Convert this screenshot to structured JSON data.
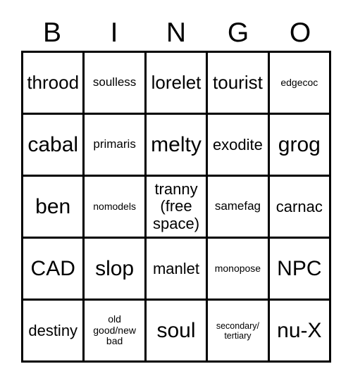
{
  "card": {
    "title_letters": [
      "B",
      "I",
      "N",
      "G",
      "O"
    ],
    "rows": [
      [
        {
          "text": "throod",
          "size": "lg"
        },
        {
          "text": "soulless",
          "size": "sm"
        },
        {
          "text": "lorelet",
          "size": "lg"
        },
        {
          "text": "tourist",
          "size": "lg"
        },
        {
          "text": "edgecoc",
          "size": "xs"
        }
      ],
      [
        {
          "text": "cabal",
          "size": "xl"
        },
        {
          "text": "primaris",
          "size": "sm"
        },
        {
          "text": "melty",
          "size": "xl"
        },
        {
          "text": "exodite",
          "size": "md"
        },
        {
          "text": "grog",
          "size": "xl"
        }
      ],
      [
        {
          "text": "ben",
          "size": "xl"
        },
        {
          "text": "nomodels",
          "size": "xs"
        },
        {
          "text": "tranny\n(free\nspace)",
          "size": "md",
          "multiline": true
        },
        {
          "text": "samefag",
          "size": "sm"
        },
        {
          "text": "carnac",
          "size": "md"
        }
      ],
      [
        {
          "text": "CAD",
          "size": "xl"
        },
        {
          "text": "slop",
          "size": "xl"
        },
        {
          "text": "manlet",
          "size": "md"
        },
        {
          "text": "monopose",
          "size": "xs"
        },
        {
          "text": "NPC",
          "size": "xl"
        }
      ],
      [
        {
          "text": "destiny",
          "size": "md"
        },
        {
          "text": "old\ngood/new\nbad",
          "size": "xs",
          "multiline": true
        },
        {
          "text": "soul",
          "size": "xl"
        },
        {
          "text": "secondary/\ntertiary",
          "size": "xxs",
          "multiline": true
        },
        {
          "text": "nu-X",
          "size": "xl"
        }
      ]
    ],
    "free_space_position": {
      "row": 2,
      "col": 2
    },
    "colors": {
      "grid_line": "#000000",
      "cell_background": "#ffffff",
      "text": "#000000",
      "page_background": "#ffffff"
    }
  }
}
